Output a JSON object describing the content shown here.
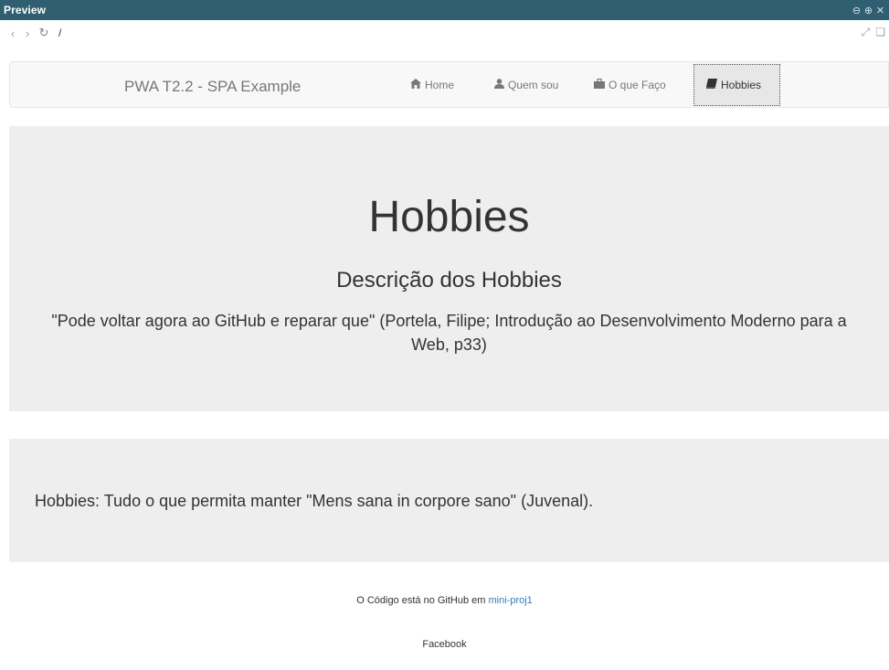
{
  "panel": {
    "title": "Preview",
    "controls": [
      "zoom-out",
      "zoom-in",
      "close"
    ]
  },
  "address_bar": {
    "back_glyph": "‹",
    "forward_glyph": "›",
    "reload_glyph": "↻",
    "path": "/"
  },
  "navbar": {
    "brand": "PWA T2.2 - SPA Example",
    "items": [
      {
        "label": "Home",
        "icon": "home-icon",
        "active": false
      },
      {
        "label": "Quem sou",
        "icon": "user-icon",
        "active": false
      },
      {
        "label": "O que Faço",
        "icon": "briefcase-icon",
        "active": false
      },
      {
        "label": "Hobbies",
        "icon": "book-icon",
        "active": true
      }
    ]
  },
  "jumbotron": {
    "title": "Hobbies",
    "subtitle": "Descrição dos Hobbies",
    "quote": "\"Pode voltar agora ao GitHub e reparar que\" (Portela, Filipe; Introdução ao Desenvolvimento Moderno para a Web, p33)"
  },
  "content": {
    "text": "Hobbies: Tudo o que permita manter \"Mens sana in corpore sano\" (Juvenal)."
  },
  "footer": {
    "code_prefix": "O Código está no GitHub em ",
    "code_link": "mini-proj1",
    "social": "Facebook"
  },
  "colors": {
    "panel_header": "#2f5f70",
    "link": "#337ab7",
    "jumbotron_bg": "#eeeeee",
    "navbar_bg": "#f8f8f8"
  }
}
